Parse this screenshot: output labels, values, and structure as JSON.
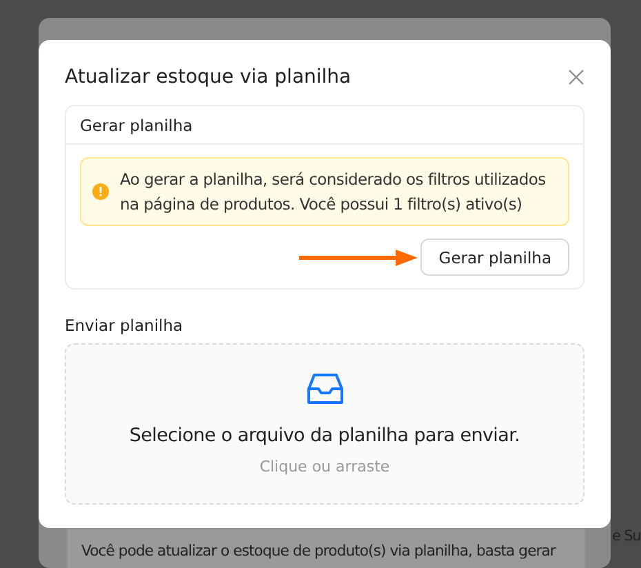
{
  "background": {
    "text": "Você pode atualizar o estoque de produto(s) via planilha, basta gerar",
    "side_text": "e Su"
  },
  "modal": {
    "title": "Atualizar estoque via planilha",
    "generate": {
      "title": "Gerar planilha",
      "alert": "Ao gerar a planilha, será considerado os filtros utilizados na página de produtos. Você possui 1 filtro(s) ativo(s)",
      "button": "Gerar planilha"
    },
    "upload": {
      "label": "Enviar planilha",
      "text": "Selecione o arquivo da planilha para enviar.",
      "hint": "Clique ou arraste"
    }
  }
}
